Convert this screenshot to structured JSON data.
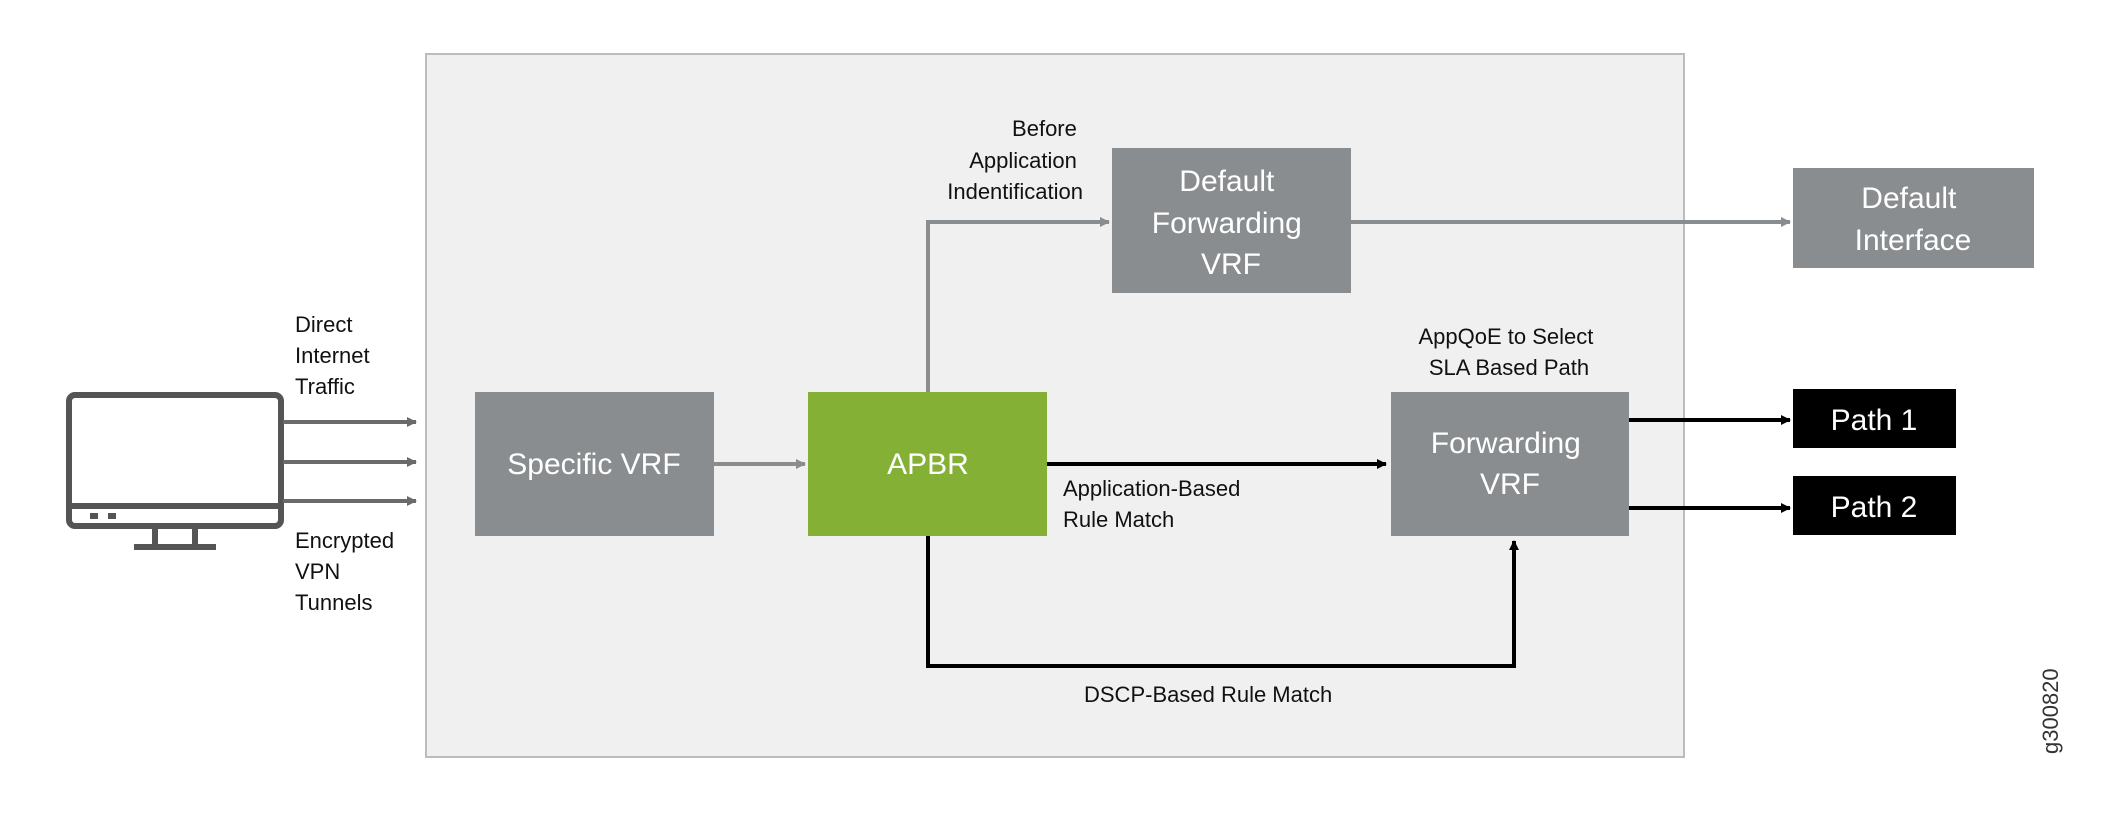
{
  "colors": {
    "container_bg": "#eff0ef",
    "container_border": "#bcbcbc",
    "gray_box": "#8a8d8f",
    "apbr_green": "#84b135",
    "path_box": "#000000",
    "gray_line": "#8a8d8f",
    "black_line": "#000000",
    "monitor": "#555555"
  },
  "source": {
    "icon": "monitor-icon",
    "label_top": [
      "Direct",
      "Internet",
      "Traffic"
    ],
    "label_bottom": [
      "Encrypted",
      "VPN",
      "Tunnels"
    ]
  },
  "nodes": {
    "specific_vrf": "Specific VRF",
    "apbr": "APBR",
    "default_forwarding_vrf": [
      "Default",
      "Forwarding",
      "VRF"
    ],
    "default_interface": [
      "Default",
      "Interface"
    ],
    "forwarding_vrf": [
      "Forwarding",
      "VRF"
    ],
    "path1": "Path 1",
    "path2": "Path 2"
  },
  "edge_labels": {
    "before_app_id": [
      "Before",
      "Application",
      "Indentification"
    ],
    "appqoe": [
      "AppQoE to Select",
      "SLA Based Path"
    ],
    "app_rule": [
      "Application-Based",
      "Rule Match"
    ],
    "dscp_rule": "DSCP-Based Rule Match"
  },
  "figure_id": "g300820"
}
